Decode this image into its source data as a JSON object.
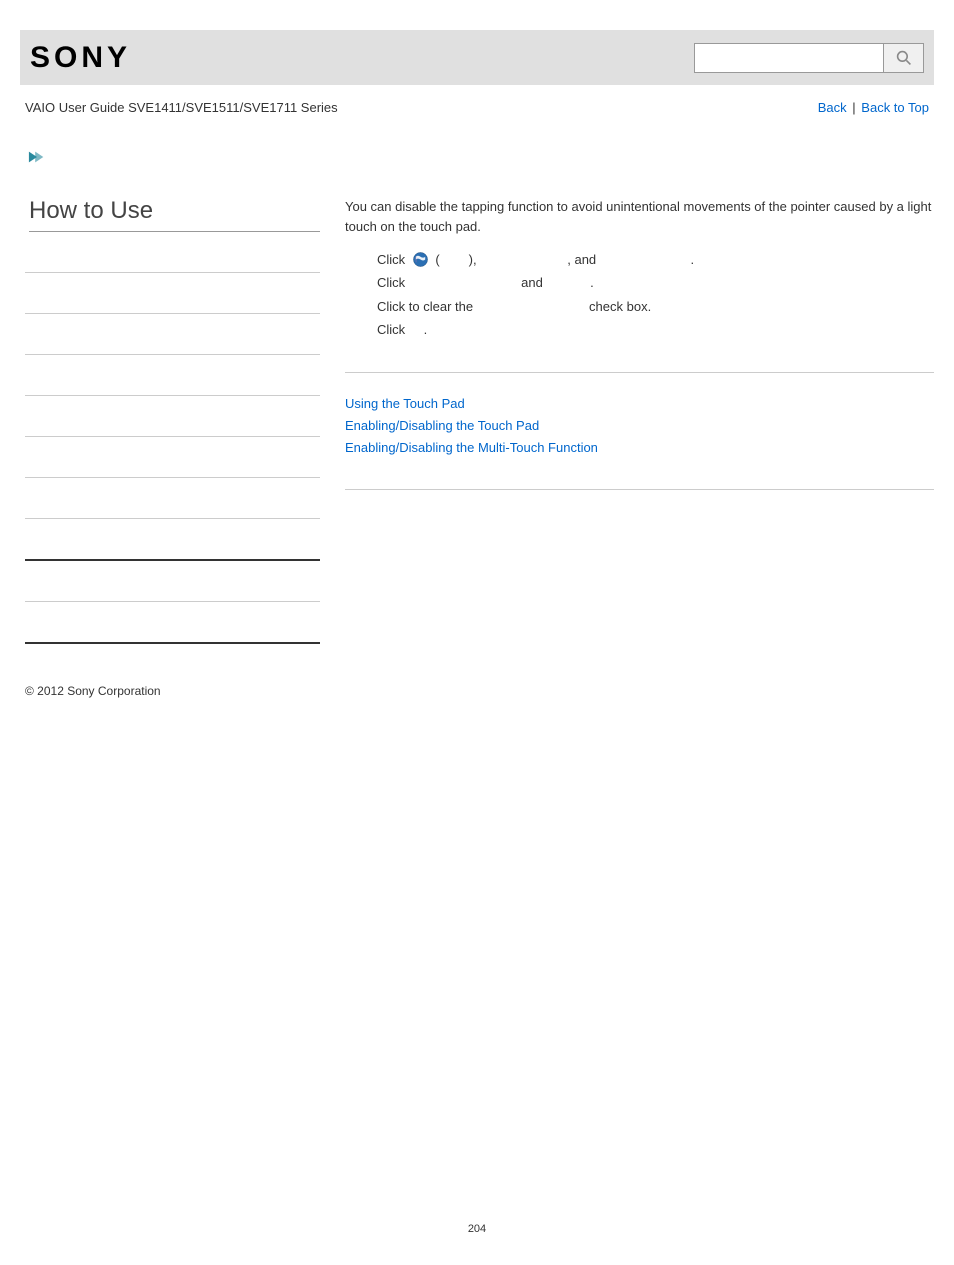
{
  "logo_text": "SONY",
  "guide_title": "VAIO User Guide SVE1411/SVE1511/SVE1711 Series",
  "top_links": {
    "back": "Back",
    "sep": " | ",
    "top": "Back to Top"
  },
  "sidebar": {
    "title": "How to Use"
  },
  "main": {
    "intro": "You can disable the tapping function to avoid unintentional movements of the pointer caused by a light touch on the touch pad.",
    "steps": {
      "s1a": "Click ",
      "s1b": " (        ), ",
      "s1c": "                       , and ",
      "s1d": "                        .",
      "s2a": "Click ",
      "s2b": "                              and ",
      "s2c": "           .",
      "s3a": "Click to clear the ",
      "s3b": "                              check box.",
      "s4a": "Click ",
      "s4b": "   ."
    },
    "related": {
      "r1": "Using the Touch Pad",
      "r2": "Enabling/Disabling the Touch Pad",
      "r3": "Enabling/Disabling the Multi-Touch Function"
    }
  },
  "copyright": "© 2012 Sony Corporation",
  "page_number": "204"
}
